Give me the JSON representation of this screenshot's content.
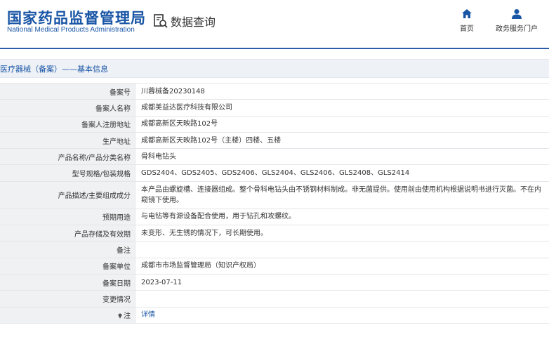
{
  "header": {
    "logo_cn": "国家药品监督管理局",
    "logo_en": "National Medical Products Administration",
    "query_label": "数据查询",
    "nav": {
      "home": "首页",
      "portal": "政务服务门户"
    }
  },
  "breadcrumb": "医疗器械（备案）——基本信息",
  "rows": [
    {
      "label": "备案号",
      "value": "川蓉械备20230148"
    },
    {
      "label": "备案人名称",
      "value": "成都美益达医疗科技有限公司"
    },
    {
      "label": "备案人注册地址",
      "value": "成都高新区天映路102号"
    },
    {
      "label": "生产地址",
      "value": "成都高新区天映路102号（主楼）四楼、五楼"
    },
    {
      "label": "产品名称/产品分类名称",
      "value": "骨科电钻头"
    },
    {
      "label": "型号规格/包装规格",
      "value": "GDS2404、GDS2405、GDS2406、GLS2404、GLS2406、GLS2408、GLS2414"
    },
    {
      "label": "产品描述/主要组成成分",
      "value": "本产品由螺旋槽、连接器组成。整个骨科电钻头由不锈钢材料制成。非无菌提供。使用前由使用机构根据说明书进行灭菌。不在内窥镜下使用。"
    },
    {
      "label": "预期用途",
      "value": "与电钻等有源设备配合使用，用于钻孔和攻螺纹。"
    },
    {
      "label": "产品存储及有效期",
      "value": "未变形、无生锈的情况下，可长期使用。"
    },
    {
      "label": "备注",
      "value": ""
    },
    {
      "label": "备案单位",
      "value": "成都市市场监督管理局（知识产权局）"
    },
    {
      "label": "备案日期",
      "value": "2023-07-11"
    },
    {
      "label": "变更情况",
      "value": ""
    },
    {
      "label": "注",
      "value": "详情"
    }
  ]
}
